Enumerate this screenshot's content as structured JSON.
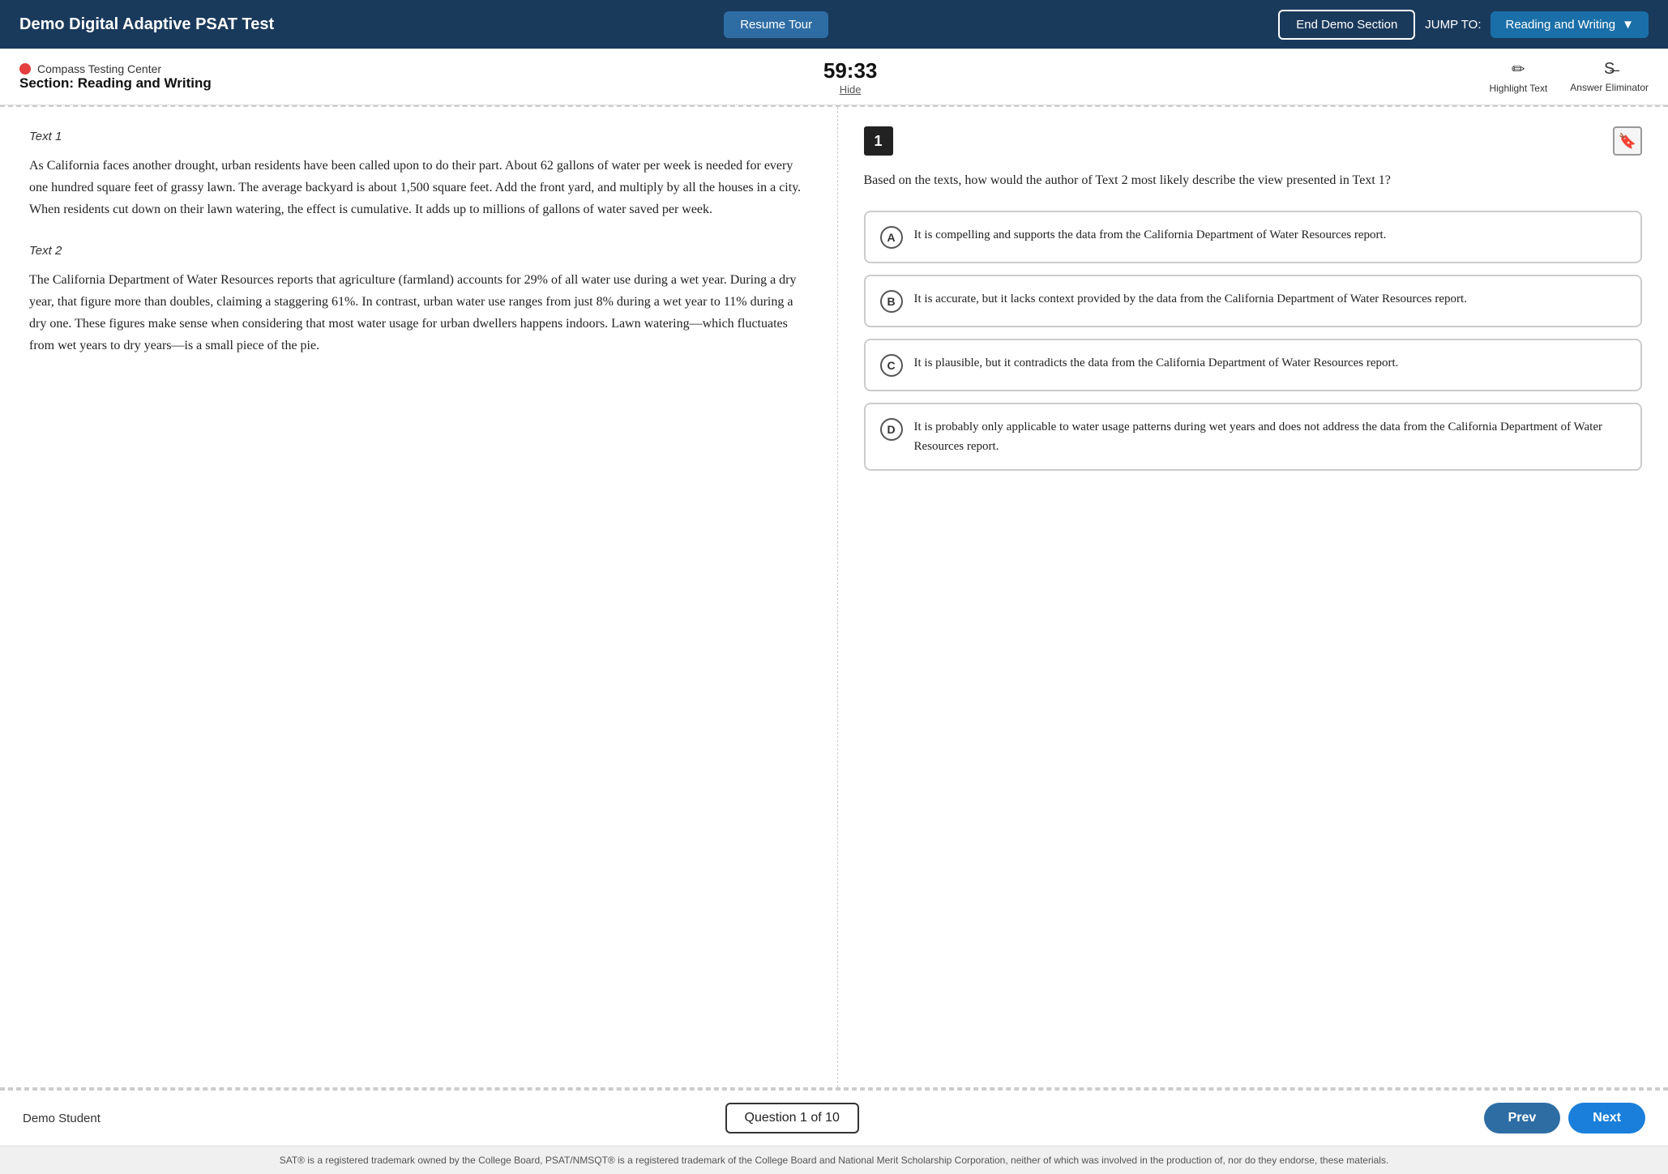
{
  "topNav": {
    "title": "Demo Digital Adaptive PSAT Test",
    "resumeTourLabel": "Resume Tour",
    "endDemoLabel": "End Demo Section",
    "jumpToLabel": "JUMP TO:",
    "jumpToValue": "Reading and Writing",
    "jumpToChevron": "▼"
  },
  "subHeader": {
    "orgName": "Compass Testing Center",
    "sectionLabel": "Section: Reading and Writing",
    "timer": "59:33",
    "hideLabel": "Hide",
    "highlightTextLabel": "Highlight Text",
    "answerEliminatorLabel": "Answer Eliminator",
    "highlightIcon": "✏",
    "elimIcon": "S̶"
  },
  "leftPanel": {
    "text1Label": "Text 1",
    "text1Content": "As California faces another drought, urban residents have been called upon to do their part. About 62 gallons of water per week is needed for every one hundred square feet of grassy lawn. The average backyard is about 1,500 square feet. Add the front yard, and multiply by all the houses in a city. When residents cut down on their lawn watering, the effect is cumulative. It adds up to millions of gallons of water saved per week.",
    "text2Label": "Text 2",
    "text2Content": "The California Department of Water Resources reports that agriculture (farmland) accounts for 29% of all water use during a wet year. During a dry year, that figure more than doubles, claiming a staggering 61%. In contrast, urban water use ranges from just 8% during a wet year to 11% during a dry one. These figures make sense when considering that most water usage for urban dwellers happens indoors. Lawn watering—which fluctuates from wet years to dry years—is a small piece of the pie."
  },
  "rightPanel": {
    "questionNumber": "1",
    "questionPrompt": "Based on the texts, how would the author of Text 2 most likely describe the view presented in Text 1?",
    "choices": [
      {
        "letter": "A",
        "text": "It is compelling and supports the data from the California Department of Water Resources report."
      },
      {
        "letter": "B",
        "text": "It is accurate, but it lacks context provided by the data from the California Department of Water Resources report."
      },
      {
        "letter": "C",
        "text": "It is plausible, but it contradicts the data from the California Department of Water Resources report."
      },
      {
        "letter": "D",
        "text": "It is probably only applicable to water usage patterns during wet years and does not address the data from the California Department of Water Resources report."
      }
    ]
  },
  "bottomBar": {
    "studentName": "Demo Student",
    "questionCounter": "Question 1 of 10",
    "prevLabel": "Prev",
    "nextLabel": "Next"
  },
  "footer": {
    "text": "SAT® is a registered trademark owned by the College Board, PSAT/NMSQT® is a registered trademark of the College Board and National Merit Scholarship Corporation, neither of which was involved in the production of, nor do they endorse, these materials."
  }
}
